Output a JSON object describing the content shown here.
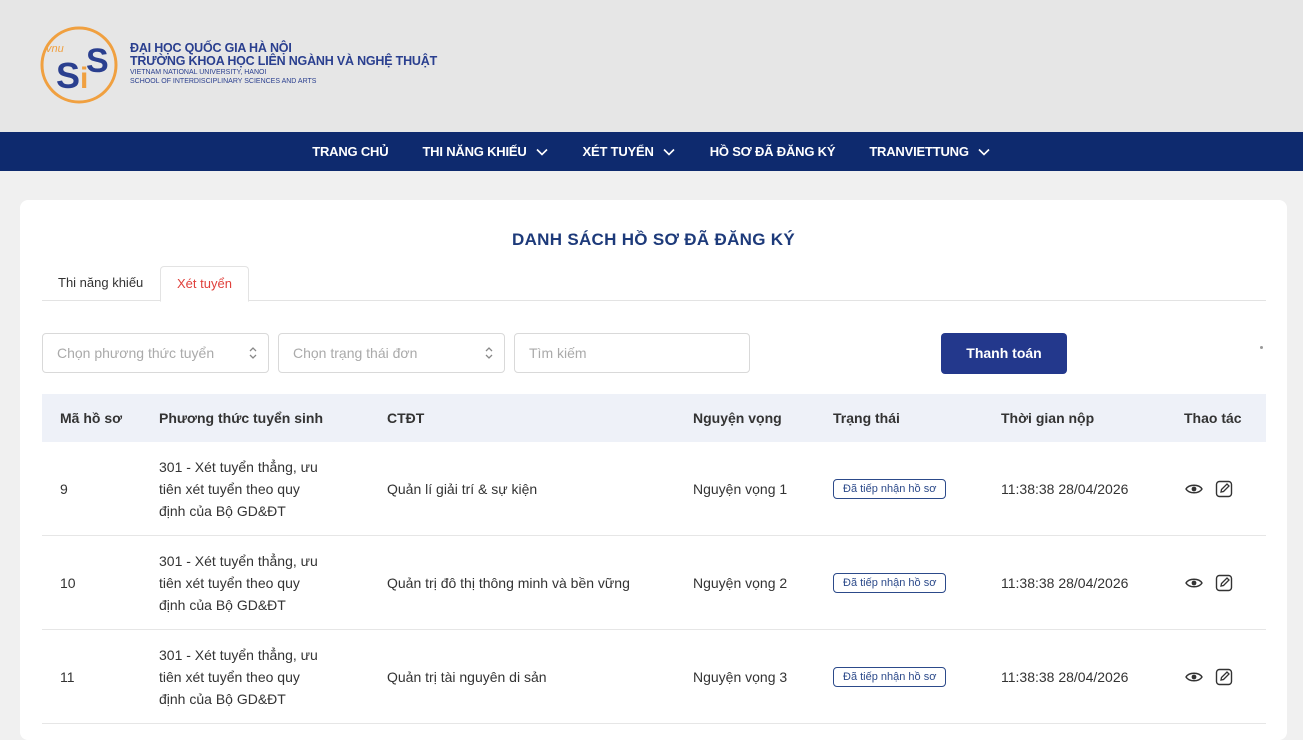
{
  "header": {
    "logo_text": "vnu SiS",
    "line1": "ĐẠI HỌC QUỐC GIA HÀ NỘI",
    "line2": "TRƯỜNG KHOA HỌC LIÊN NGÀNH VÀ NGHỆ THUẬT",
    "line3": "VIETNAM NATIONAL UNIVERSITY, HANOI",
    "line4": "SCHOOL OF INTERDISCIPLINARY SCIENCES AND ARTS"
  },
  "nav": {
    "items": [
      {
        "label": "TRANG CHỦ",
        "dropdown": false
      },
      {
        "label": "THI NĂNG KHIẾU",
        "dropdown": true
      },
      {
        "label": "XÉT TUYỂN",
        "dropdown": true
      },
      {
        "label": "HỒ SƠ ĐÃ ĐĂNG KÝ",
        "dropdown": false
      },
      {
        "label": "TRANVIETTUNG",
        "dropdown": true
      }
    ]
  },
  "page": {
    "title": "DANH SÁCH HỒ SƠ ĐÃ ĐĂNG KÝ",
    "tabs": [
      {
        "label": "Thi năng khiếu",
        "active": false
      },
      {
        "label": "Xét tuyển",
        "active": true
      }
    ]
  },
  "filters": {
    "method_placeholder": "Chọn phương thức tuyển",
    "status_placeholder": "Chọn trạng thái đơn",
    "search_placeholder": "Tìm kiếm",
    "pay_button": "Thanh toán"
  },
  "table": {
    "columns": [
      "Mã hồ sơ",
      "Phương thức tuyển sinh",
      "CTĐT",
      "Nguyện vọng",
      "Trạng thái",
      "Thời gian nộp",
      "Thao tác"
    ],
    "rows": [
      {
        "id": "9",
        "method": [
          "301 - Xét tuyển thẳng, ưu",
          "tiên xét tuyển theo quy",
          "định của Bộ GD&ĐT"
        ],
        "program": "Quản lí giải trí & sự kiện",
        "wish": "Nguyện vọng 1",
        "status": "Đã tiếp nhận hồ sơ",
        "time": "11:38:38 28/04/2026"
      },
      {
        "id": "10",
        "method": [
          "301 - Xét tuyển thẳng, ưu",
          "tiên xét tuyển theo quy",
          "định của Bộ GD&ĐT"
        ],
        "program": "Quản trị đô thị thông minh và bền vững",
        "wish": "Nguyện vọng 2",
        "status": "Đã tiếp nhận hồ sơ",
        "time": "11:38:38 28/04/2026"
      },
      {
        "id": "11",
        "method": [
          "301 - Xét tuyển thẳng, ưu",
          "tiên xét tuyển theo quy",
          "định của Bộ GD&ĐT"
        ],
        "program": "Quản trị tài nguyên di sản",
        "wish": "Nguyện vọng 3",
        "status": "Đã tiếp nhận hồ sơ",
        "time": "11:38:38 28/04/2026"
      }
    ]
  },
  "colors": {
    "nav_bg": "#0e2a6e",
    "title": "#1d3a7a",
    "active_tab": "#e0413c",
    "button": "#23388c",
    "logo_orange": "#f0a040"
  }
}
